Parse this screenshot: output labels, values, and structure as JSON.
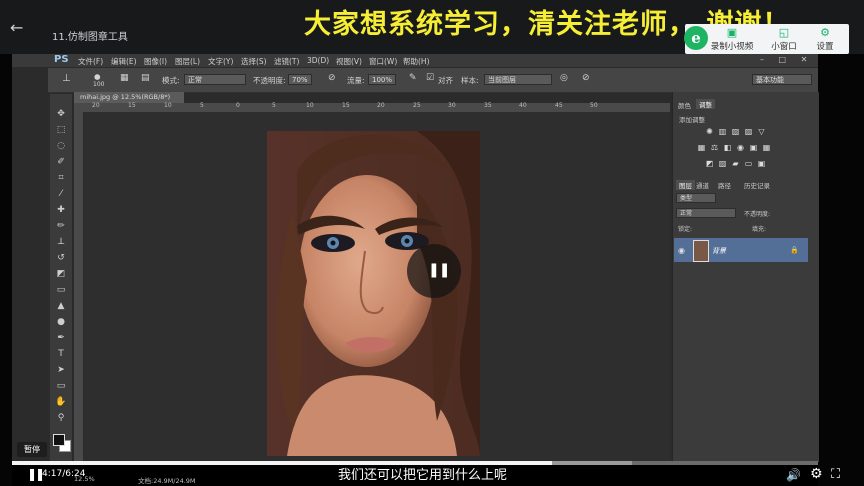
{
  "header": {
    "back_icon": "arrow-left-icon",
    "video_title": "11.仿制图章工具",
    "banner": "大家想系统学习，清关注老师， 谢谢！"
  },
  "tools": {
    "record": "录制小视频",
    "mini_window": "小窗口",
    "settings": "设置"
  },
  "photoshop": {
    "logo": "PS",
    "menu": [
      "文件(F)",
      "编辑(E)",
      "图像(I)",
      "图层(L)",
      "文字(Y)",
      "选择(S)",
      "滤镜(T)",
      "3D(D)",
      "视图(V)",
      "窗口(W)",
      "帮助(H)"
    ],
    "options": {
      "brush_size": "100",
      "mode_label": "模式:",
      "mode_value": "正常",
      "opacity_label": "不透明度:",
      "opacity_value": "70%",
      "flow_label": "流量:",
      "flow_value": "100%",
      "align_label": "对齐",
      "sample_label": "样本:",
      "sample_value": "当前图层",
      "workspace": "基本功能"
    },
    "doc_tab": "mihai.jpg @ 12.5%(RGB/8*)",
    "ruler_numbers": [
      "20",
      "15",
      "10",
      "5",
      "0",
      "5",
      "10",
      "15",
      "20",
      "25",
      "30",
      "35",
      "40",
      "45",
      "50"
    ],
    "panels": {
      "adjust_tabs": [
        "颜色",
        "调整"
      ],
      "adjust_title": "添加调整",
      "layers_tabs": [
        "图层",
        "通道",
        "路径",
        "历史记录"
      ],
      "kind_label": "类型",
      "blend_value": "正常",
      "opacity_label": "不透明度:",
      "lock_label": "锁定:",
      "fill_label": "填充:",
      "layer_name": "背景"
    },
    "status": {
      "zoom": "12.5%",
      "doc": "文档:24.9M/24.9M"
    }
  },
  "player": {
    "tooltip": "暂停",
    "time": "4:17/6:24",
    "progress": 0.67,
    "subtitle": "我们还可以把它用到什么上呢"
  }
}
